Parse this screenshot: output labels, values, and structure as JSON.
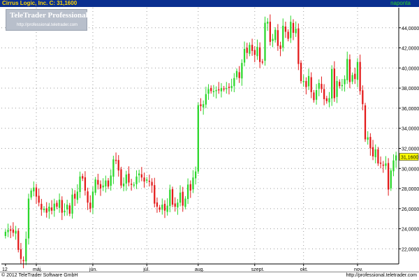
{
  "header": {
    "title": "Cirrus Logic, Inc.  C: 31,1600",
    "period": "napontа"
  },
  "watermark": {
    "brand": "TeleTrader Professional",
    "url": "http://professional.teletrader.com"
  },
  "footer": {
    "copyright": "© 2012 TeleTrader Software GmbH",
    "site": "http://professional.teletrader.com"
  },
  "colors": {
    "up": "#2bd72b",
    "down": "#e31a1a",
    "header_bg": "#0a2f8f",
    "header_text": "#ffd700",
    "last_price_bg": "#ffff00"
  },
  "chart_data": {
    "type": "candlestick",
    "ylim": [
      20.5,
      46
    ],
    "grid": true,
    "y_ticks": [
      "22,0000",
      "24,0000",
      "26,0000",
      "28,0000",
      "30,0000",
      "32,0000",
      "34,0000",
      "36,0000",
      "38,0000",
      "40,0000",
      "42,0000",
      "44,0000"
    ],
    "y_tick_values": [
      22,
      24,
      26,
      28,
      30,
      32,
      34,
      36,
      38,
      40,
      42,
      44
    ],
    "x_labels": [
      {
        "label": "12",
        "index": 0
      },
      {
        "label": "máj.",
        "index": 12
      },
      {
        "label": "jún.",
        "index": 34
      },
      {
        "label": "júl.",
        "index": 55
      },
      {
        "label": "aug.",
        "index": 75
      },
      {
        "label": "szept.",
        "index": 97
      },
      {
        "label": "okt.",
        "index": 116
      },
      {
        "label": "nov.",
        "index": 137
      }
    ],
    "last_price": 31.16,
    "last_price_label": "31,1600",
    "closes": [
      23.7,
      23.9,
      23.8,
      23.6,
      23.8,
      21.9,
      21.0,
      20.8,
      23.0,
      27.0,
      27.8,
      28.1,
      27.2,
      26.6,
      25.9,
      26.0,
      25.6,
      26.2,
      25.8,
      26.5,
      26.2,
      26.9,
      25.6,
      25.8,
      26.4,
      25.5,
      27.4,
      27.0,
      27.7,
      29.2,
      29.0,
      27.8,
      26.6,
      26.0,
      27.7,
      28.9,
      28.4,
      28.0,
      28.3,
      28.8,
      28.2,
      29.3,
      30.9,
      30.8,
      29.8,
      28.3,
      28.5,
      29.4,
      28.6,
      28.4,
      28.4,
      29.2,
      29.5,
      29.1,
      28.7,
      28.9,
      28.7,
      28.3,
      26.5,
      26.2,
      25.9,
      26.4,
      25.8,
      26.3,
      27.9,
      26.4,
      26.2,
      26.6,
      27.6,
      26.3,
      27.0,
      28.4,
      27.8,
      29.1,
      29.7,
      36.3,
      36.2,
      36.4,
      37.4,
      37.9,
      37.7,
      37.7,
      37.8,
      37.8,
      38.0,
      37.9,
      38.0,
      38.1,
      38.2,
      39.0,
      39.7,
      39.0,
      40.5,
      41.9,
      41.5,
      42.3,
      41.7,
      41.3,
      42.1,
      40.6,
      40.6,
      44.5,
      44.6,
      42.6,
      42.9,
      43.8,
      42.2,
      41.9,
      44.2,
      43.6,
      42.9,
      44.6,
      43.5,
      43.9,
      40.4,
      38.7,
      38.7,
      38.1,
      39.2,
      37.6,
      36.8,
      37.8,
      38.5,
      37.9,
      36.9,
      36.7,
      37.0,
      39.9,
      37.0,
      38.7,
      38.2,
      38.3,
      38.9,
      40.9,
      38.6,
      39.3,
      38.9,
      40.6,
      37.7,
      36.4,
      32.9,
      33.1,
      32.0,
      31.2,
      31.9,
      30.5,
      30.5,
      30.3,
      30.5,
      27.9,
      29.8,
      30.8,
      31.3
    ]
  }
}
